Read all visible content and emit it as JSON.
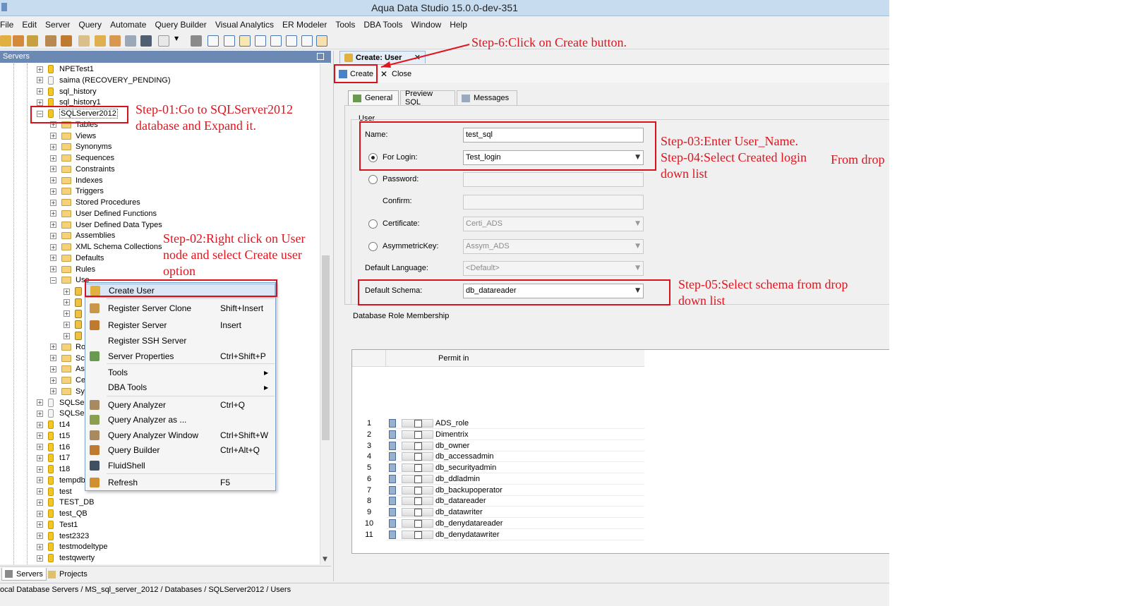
{
  "window": {
    "title": "Aqua Data Studio 15.0.0-dev-351"
  },
  "menu": [
    "File",
    "Edit",
    "Server",
    "Query",
    "Automate",
    "Query Builder",
    "Visual Analytics",
    "ER Modeler",
    "Tools",
    "DBA Tools",
    "Window",
    "Help"
  ],
  "servers_panel": {
    "title": "Servers",
    "tree": [
      {
        "label": "NPETest1",
        "type": "db"
      },
      {
        "label": "saima (RECOVERY_PENDING)",
        "type": "db-grey"
      },
      {
        "label": "sql_history",
        "type": "db"
      },
      {
        "label": "sql_history1",
        "type": "db"
      },
      {
        "label": "SQLServer2012",
        "type": "db",
        "expanded": true
      },
      {
        "label": "Tables",
        "type": "folder"
      },
      {
        "label": "Views",
        "type": "folder"
      },
      {
        "label": "Synonyms",
        "type": "folder"
      },
      {
        "label": "Sequences",
        "type": "folder"
      },
      {
        "label": "Constraints",
        "type": "folder"
      },
      {
        "label": "Indexes",
        "type": "folder"
      },
      {
        "label": "Triggers",
        "type": "folder"
      },
      {
        "label": "Stored Procedures",
        "type": "folder"
      },
      {
        "label": "User Defined Functions",
        "type": "folder"
      },
      {
        "label": "User Defined Data Types",
        "type": "folder"
      },
      {
        "label": "Assemblies",
        "type": "folder"
      },
      {
        "label": "XML Schema Collections",
        "type": "folder"
      },
      {
        "label": "Defaults",
        "type": "folder"
      },
      {
        "label": "Rules",
        "type": "folder"
      },
      {
        "label": "Use",
        "type": "folder-open"
      },
      {
        "label": "",
        "type": "user"
      },
      {
        "label": "",
        "type": "user"
      },
      {
        "label": "",
        "type": "user"
      },
      {
        "label": "",
        "type": "user"
      },
      {
        "label": "",
        "type": "user"
      },
      {
        "label": "Rol",
        "type": "folder"
      },
      {
        "label": "Sch",
        "type": "folder"
      },
      {
        "label": "Asy",
        "type": "folder"
      },
      {
        "label": "Cer",
        "type": "folder"
      },
      {
        "label": "Syn",
        "type": "folder"
      },
      {
        "label": "SQLSer",
        "type": "db-grey"
      },
      {
        "label": "SQLSer",
        "type": "db-grey"
      },
      {
        "label": "t14",
        "type": "db"
      },
      {
        "label": "t15",
        "type": "db"
      },
      {
        "label": "t16",
        "type": "db"
      },
      {
        "label": "t17",
        "type": "db"
      },
      {
        "label": "t18",
        "type": "db"
      },
      {
        "label": "tempdb",
        "type": "db"
      },
      {
        "label": "test",
        "type": "db"
      },
      {
        "label": "TEST_DB",
        "type": "db"
      },
      {
        "label": "test_QB",
        "type": "db"
      },
      {
        "label": "Test1",
        "type": "db"
      },
      {
        "label": "test2323",
        "type": "db"
      },
      {
        "label": "testmodeltype",
        "type": "db"
      },
      {
        "label": "testqwerty",
        "type": "db"
      }
    ]
  },
  "bottom_tabs": [
    "Servers",
    "Projects"
  ],
  "context_menu": [
    {
      "label": "Create User",
      "shortcut": "",
      "highlighted": true
    },
    {
      "label": "Register Server Clone",
      "shortcut": "Shift+Insert"
    },
    {
      "label": "Register Server",
      "shortcut": "Insert"
    },
    {
      "label": "Register SSH Server",
      "shortcut": ""
    },
    {
      "label": "Server Properties",
      "shortcut": "Ctrl+Shift+P"
    },
    {
      "label": "Tools",
      "shortcut": "",
      "submenu": true
    },
    {
      "label": "DBA Tools",
      "shortcut": "",
      "submenu": true
    },
    {
      "label": "Query Analyzer",
      "shortcut": "Ctrl+Q"
    },
    {
      "label": "Query Analyzer as ...",
      "shortcut": ""
    },
    {
      "label": "Query Analyzer Window",
      "shortcut": "Ctrl+Shift+W"
    },
    {
      "label": "Query Builder",
      "shortcut": "Ctrl+Alt+Q"
    },
    {
      "label": "FluidShell",
      "shortcut": ""
    },
    {
      "label": "Refresh",
      "shortcut": "F5"
    }
  ],
  "editor": {
    "tab_title": "Create: User",
    "tab_close": "✕",
    "toolbar": {
      "create": "Create",
      "close": "Close"
    },
    "subtabs": [
      "General",
      "Preview SQL",
      "Messages"
    ],
    "group_label": "User",
    "form": {
      "name_label": "Name:",
      "name_value": "test_sql",
      "for_login_label": "For Login:",
      "for_login_value": "Test_login",
      "password_label": "Password:",
      "confirm_label": "Confirm:",
      "certificate_label": "Certificate:",
      "certificate_value": "Certi_ADS",
      "asymkey_label": "AsymmetricKey:",
      "asymkey_value": "Assym_ADS",
      "default_language_label": "Default Language:",
      "default_language_value": "<Default>",
      "default_schema_label": "Default Schema:",
      "default_schema_value": "db_datareader"
    },
    "role_section_label": "Database Role Membership",
    "role_column": "Permit in",
    "roles": [
      {
        "num": "1",
        "name": "ADS_role"
      },
      {
        "num": "2",
        "name": "Dimentrix"
      },
      {
        "num": "3",
        "name": "db_owner"
      },
      {
        "num": "4",
        "name": "db_accessadmin"
      },
      {
        "num": "5",
        "name": "db_securityadmin"
      },
      {
        "num": "6",
        "name": "db_ddladmin"
      },
      {
        "num": "7",
        "name": "db_backupoperator"
      },
      {
        "num": "8",
        "name": "db_datareader"
      },
      {
        "num": "9",
        "name": "db_datawriter"
      },
      {
        "num": "10",
        "name": "db_denydatareader"
      },
      {
        "num": "11",
        "name": "db_denydatawriter"
      }
    ]
  },
  "status_path": "ocal Database Servers / MS_sql_server_2012 / Databases / SQLServer2012 / Users",
  "annotations": {
    "step1_line1": "Step-01:Go to SQLServer2012",
    "step1_line2": "database and Expand it.",
    "step2_line1": "Step-02:Right click on User",
    "step2_line2": "node and select Create user",
    "step2_line3": "option",
    "step3": "Step-03:Enter User_Name.",
    "step4_line1": "Step-04:Select Created login",
    "step4_extra": "From drop",
    "step4_line2": "down list",
    "step5_line1": "Step-05:Select schema from drop",
    "step5_line2": "down list",
    "step6": "Step-6:Click on Create button."
  },
  "colors": {
    "annotation": "#e0141e",
    "title_bar": "#c8dcf0",
    "panel_header": "#6b89b2"
  }
}
